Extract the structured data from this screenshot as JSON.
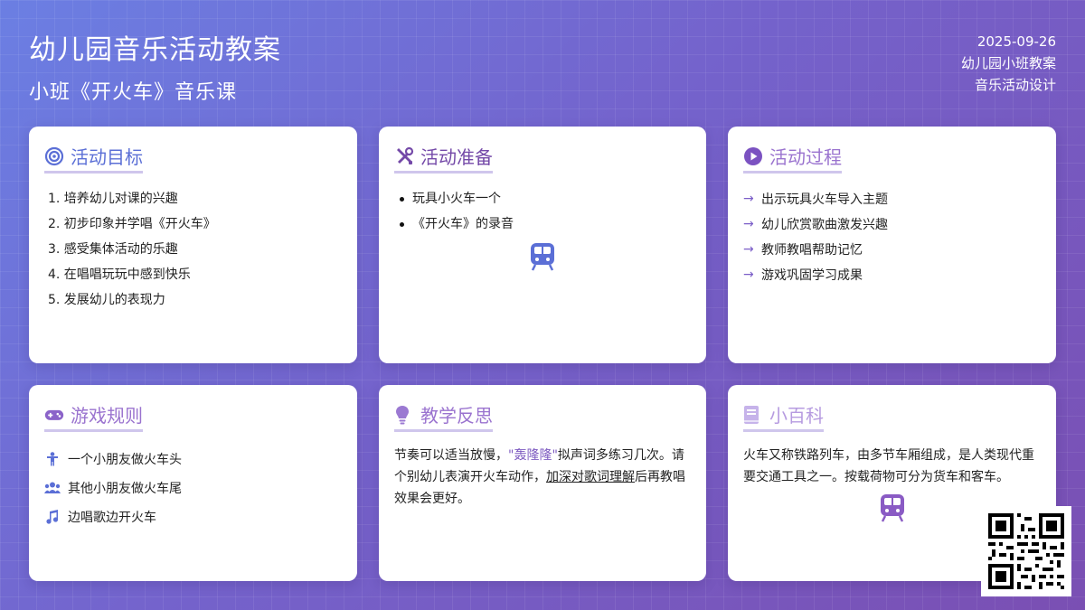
{
  "header": {
    "title": "幼儿园音乐活动教案",
    "subtitle": "小班《开火车》音乐课"
  },
  "meta": {
    "date": "2025-09-26",
    "line2": "幼儿园小班教案",
    "line3": "音乐活动设计"
  },
  "cards": {
    "goals": {
      "title": "活动目标",
      "icon": "target-icon",
      "items": [
        "1. 培养幼儿对课的兴趣",
        "2. 初步印象并学唱《开火车》",
        "3. 感受集体活动的乐趣",
        "4. 在唱唱玩玩中感到快乐",
        "5. 发展幼儿的表现力"
      ]
    },
    "prep": {
      "title": "活动准备",
      "icon": "tools-icon",
      "items": [
        "玩具小火车一个",
        "《开火车》的录音"
      ],
      "illustration": "train-icon"
    },
    "process": {
      "title": "活动过程",
      "icon": "play-circle-icon",
      "items": [
        "出示玩具火车导入主题",
        "幼儿欣赏歌曲激发兴趣",
        "教师教唱帮助记忆",
        "游戏巩固学习成果"
      ]
    },
    "rules": {
      "title": "游戏规则",
      "icon": "gamepad-icon",
      "items": [
        {
          "icon": "child-icon",
          "text": "一个小朋友做火车头"
        },
        {
          "icon": "users-icon",
          "text": "其他小朋友做火车尾"
        },
        {
          "icon": "music-note-icon",
          "text": "边唱歌边开火车"
        }
      ]
    },
    "reflection": {
      "title": "教学反思",
      "icon": "lightbulb-icon",
      "p1": "节奏可以适当放慢，",
      "p2": "\"轰隆隆\"",
      "p3": "拟声词多练习几次。请个别幼儿表演开火车动作，",
      "p4": "加深对歌词理解",
      "p5": "后再教唱效果会更好。"
    },
    "encyclopedia": {
      "title": "小百科",
      "icon": "book-icon",
      "text": "火车又称铁路列车，由多节车厢组成，是人类现代重要交通工具之一。按载荷物可分为货车和客车。",
      "illustration": "train-icon"
    }
  },
  "colors": {
    "bg_start": "#6b7fe3",
    "bg_end": "#7a4fb3",
    "blue": "#5b6fd6",
    "purple": "#7449a8",
    "violet": "#9a73cf",
    "lilac": "#b69be0"
  }
}
